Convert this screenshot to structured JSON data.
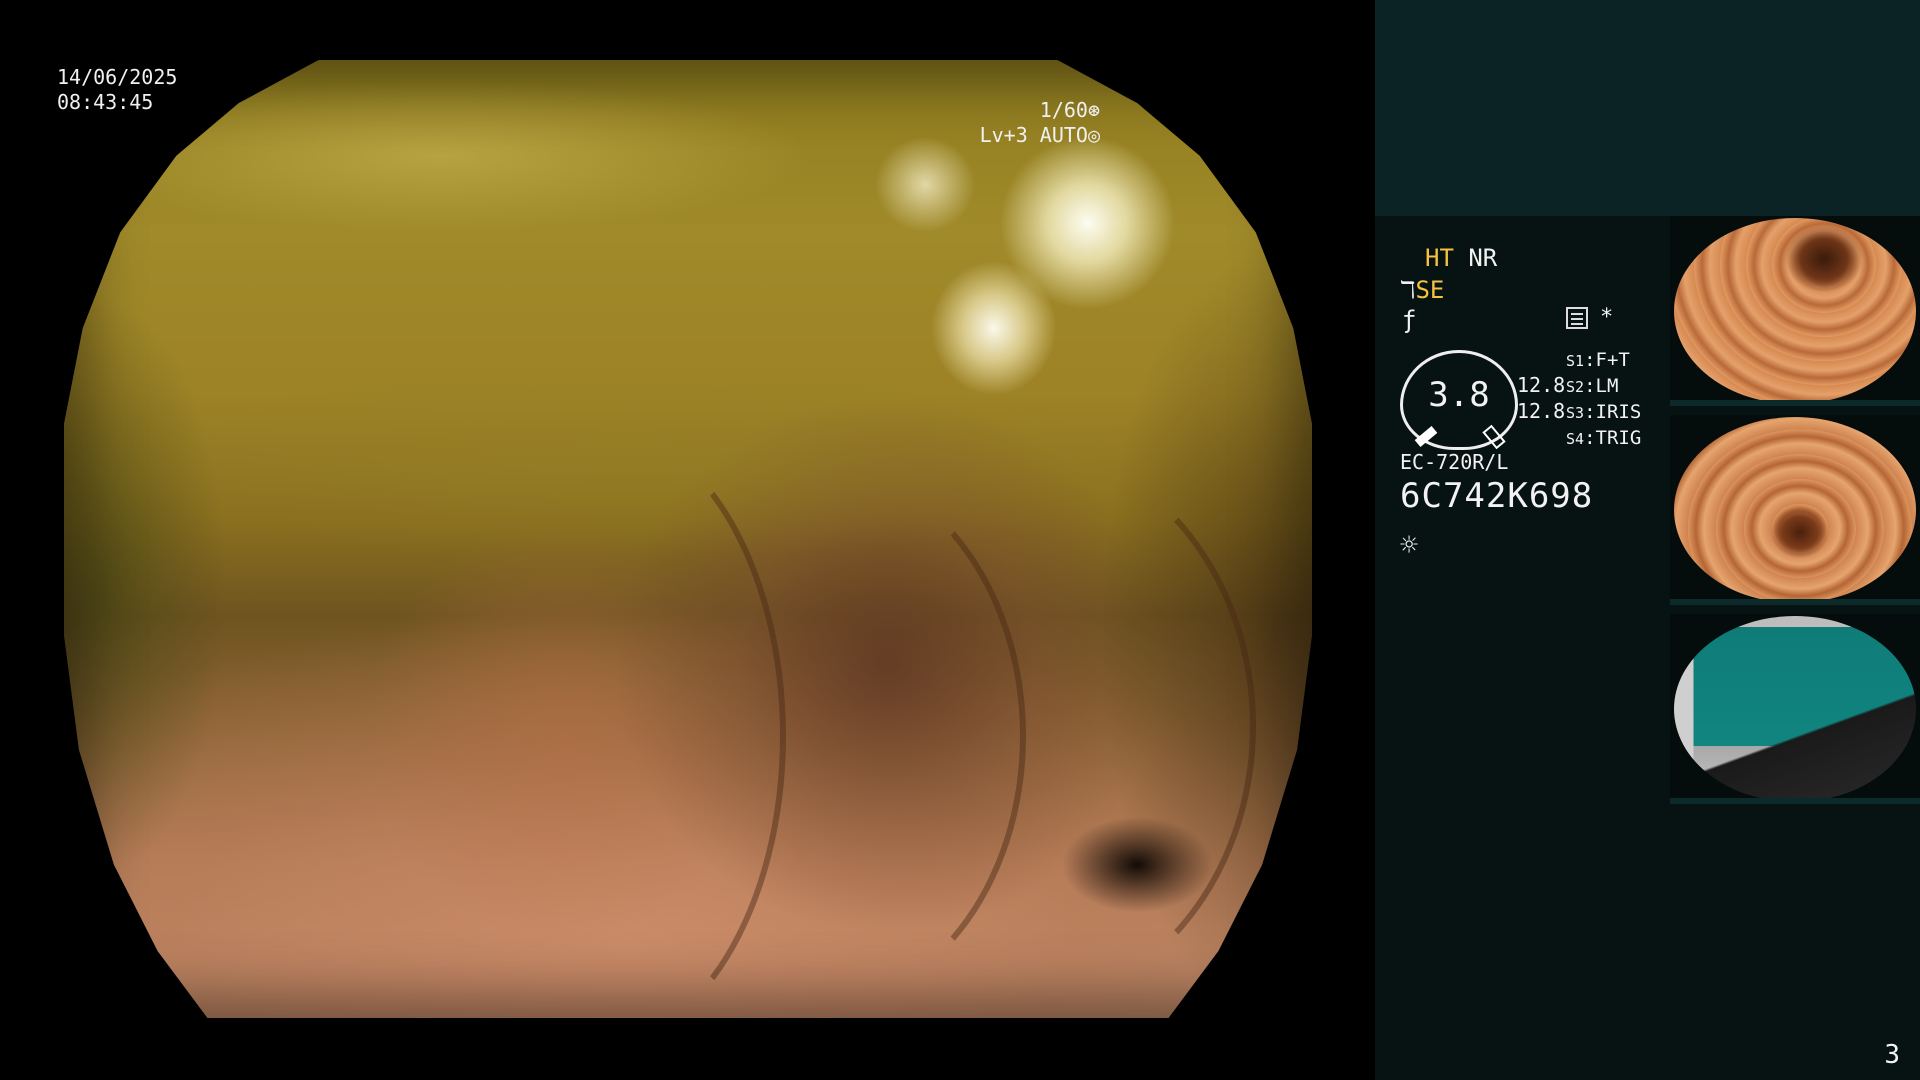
{
  "osd": {
    "date": "14/06/2025",
    "time": "08:43:45",
    "shutter": "1/60",
    "shutter_icon": "aperture-icon",
    "level_mode": "Lv+3 AUTO",
    "level_icon": "iris-icon"
  },
  "panel": {
    "ht": "HT",
    "nr": "NR",
    "se": "SE",
    "se_icon": "structure-enhance-icon",
    "f_icon": "f-curve-icon",
    "menu_icon": "menu-list-icon",
    "star": "*",
    "gauge_value": "3.8",
    "gauge_side_1": "12.8",
    "gauge_side_2": "12.8",
    "switches": [
      {
        "key": "S1",
        "value": "F+T"
      },
      {
        "key": "S2",
        "value": "LM"
      },
      {
        "key": "S3",
        "value": "IRIS"
      },
      {
        "key": "S4",
        "value": "TRIG"
      }
    ],
    "scope_model": "EC-720R/L",
    "serial": "6C742K698",
    "light_icon": "light-source-icon",
    "page_number": "3"
  },
  "colors": {
    "accent_yellow": "#f5c242",
    "panel_top": "#0b2325",
    "panel_main": "#061312"
  }
}
